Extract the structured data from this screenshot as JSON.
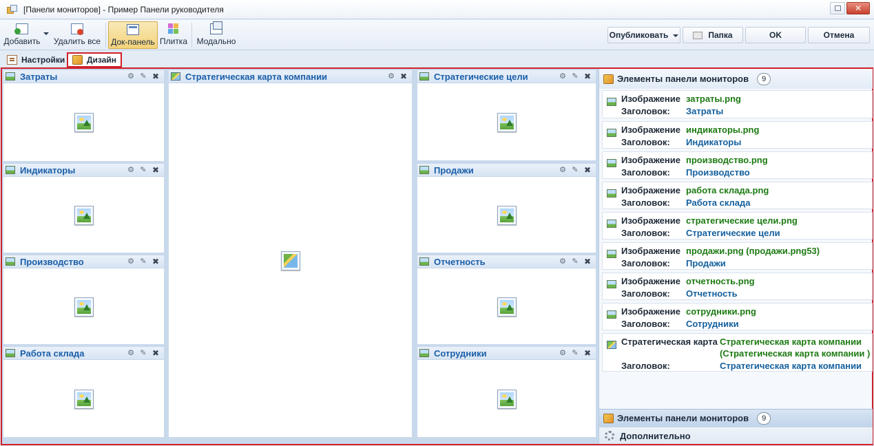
{
  "window": {
    "title": "[Панели мониторов] - Пример Панели руководителя",
    "close_glyph": "✕"
  },
  "toolbar": {
    "add_label": "Добавить",
    "delete_all_label": "Удалить все",
    "dock_label": "Док-панель",
    "tile_label": "Плитка",
    "modal_label": "Модально",
    "publish_label": "Опубликовать",
    "folder_label": "Папка",
    "ok_label": "OK",
    "cancel_label": "Отмена"
  },
  "tabs": [
    {
      "label": "Настройки",
      "active": false
    },
    {
      "label": "Дизайн",
      "active": true
    }
  ],
  "panels": {
    "left": [
      "Затраты",
      "Индикаторы",
      "Производство",
      "Работа склада"
    ],
    "center": "Стратегическая карта компании",
    "right": [
      "Стратегические цели",
      "Продажи",
      "Отчетность",
      "Сотрудники"
    ]
  },
  "panel_tools": {
    "settings": "⚙",
    "pin": "✎",
    "close": "✖"
  },
  "elements": {
    "title": "Элементы панели мониторов",
    "count": "9",
    "items": [
      {
        "type": "Изображение",
        "value": "затраты.png",
        "caption_label": "Заголовок:",
        "caption": "Затраты"
      },
      {
        "type": "Изображение",
        "value": "индикаторы.png",
        "caption_label": "Заголовок:",
        "caption": "Индикаторы"
      },
      {
        "type": "Изображение",
        "value": "производство.png",
        "caption_label": "Заголовок:",
        "caption": "Производство"
      },
      {
        "type": "Изображение",
        "value": "работа склада.png",
        "caption_label": "Заголовок:",
        "caption": "Работа склада"
      },
      {
        "type": "Изображение",
        "value": "стратегические цели.png",
        "caption_label": "Заголовок:",
        "caption": "Стратегические цели"
      },
      {
        "type": "Изображение",
        "value": "продажи.png (продажи.png53)",
        "caption_label": "Заголовок:",
        "caption": "Продажи"
      },
      {
        "type": "Изображение",
        "value": "отчетность.png",
        "caption_label": "Заголовок:",
        "caption": "Отчетность"
      },
      {
        "type": "Изображение",
        "value": "сотрудники.png",
        "caption_label": "Заголовок:",
        "caption": "Сотрудники"
      },
      {
        "type": "Стратегическая карта",
        "value": "Стратегическая карта компании",
        "value_line2": "(Стратегическая карта компании )",
        "caption_label": "Заголовок:",
        "caption": "Стратегическая карта компании"
      }
    ]
  },
  "footer": {
    "elements_title": "Элементы панели мониторов",
    "elements_count": "9",
    "extra_title": "Дополнительно"
  }
}
